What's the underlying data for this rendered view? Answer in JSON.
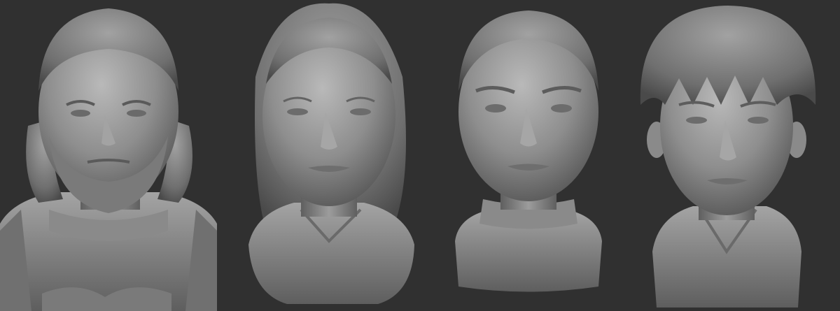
{
  "scene": {
    "background": "#303030",
    "clay_color": "#8c8c8c",
    "busts": [
      {
        "name": "bearded-man-armor"
      },
      {
        "name": "woman-long-hair"
      },
      {
        "name": "woman-braided-hair"
      },
      {
        "name": "young-man-fringe"
      }
    ]
  }
}
